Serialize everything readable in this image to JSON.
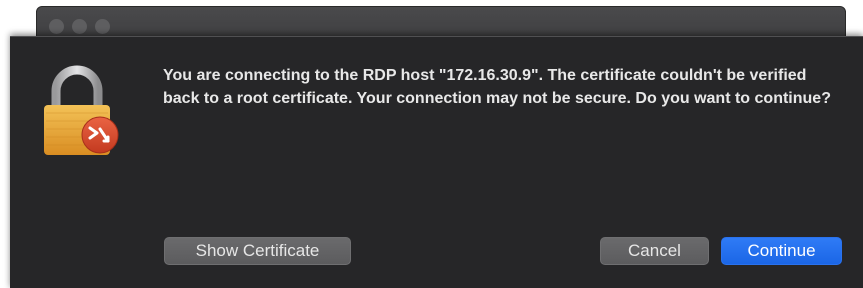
{
  "dialog": {
    "message": "You are connecting to the RDP host \"172.16.30.9\". The certificate couldn't be verified back to a root certificate. Your connection may not be secure. Do you want to continue?",
    "icon": "lock-with-remote-desktop-badge-icon"
  },
  "buttons": {
    "show_certificate": "Show Certificate",
    "cancel": "Cancel",
    "continue": "Continue"
  },
  "colors": {
    "dialog_background": "#262628",
    "primary_button": "#1f6ef0",
    "badge": "#d9472b",
    "lock_body": "#e9a93a"
  }
}
